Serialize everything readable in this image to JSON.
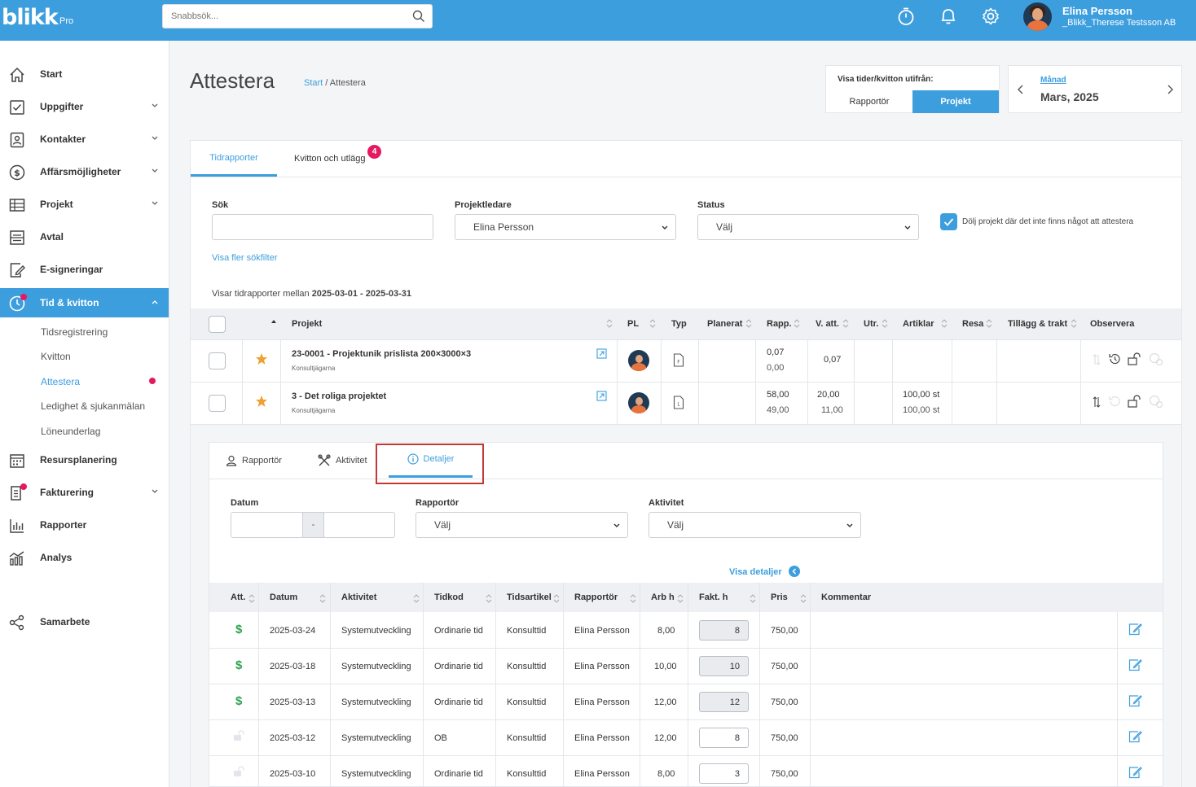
{
  "app": {
    "logo": "blikk",
    "logo_sub": "Pro"
  },
  "search": {
    "placeholder": "Snabbsök..."
  },
  "user": {
    "name": "Elina Persson",
    "company": "_Blikk_Therese Testsson AB"
  },
  "sidebar": {
    "items": [
      {
        "label": "Start",
        "icon": "home-icon"
      },
      {
        "label": "Uppgifter",
        "icon": "checkbox-icon"
      },
      {
        "label": "Kontakter",
        "icon": "contact-icon"
      },
      {
        "label": "Affärsmöjligheter",
        "icon": "dollar-icon"
      },
      {
        "label": "Projekt",
        "icon": "table-icon"
      },
      {
        "label": "Avtal",
        "icon": "contract-icon"
      },
      {
        "label": "E-signeringar",
        "icon": "signature-icon"
      },
      {
        "label": "Tid & kvitton",
        "icon": "clock-icon"
      },
      {
        "label": "Resursplanering",
        "icon": "calendar-icon"
      },
      {
        "label": "Fakturering",
        "icon": "invoice-icon"
      },
      {
        "label": "Rapporter",
        "icon": "bar-chart-icon"
      },
      {
        "label": "Analys",
        "icon": "analytics-icon"
      },
      {
        "label": "Samarbete",
        "icon": "share-icon"
      }
    ],
    "sub_items": [
      "Tidsregistrering",
      "Kvitton",
      "Attestera",
      "Ledighet & sjukanmälan",
      "Löneunderlag"
    ]
  },
  "page": {
    "title": "Attestera",
    "breadcrumb_link": "Start",
    "breadcrumb_sep": " / ",
    "breadcrumb_current": "Attestera"
  },
  "view_toggle": {
    "label": "Visa tider/kvitton utifrån:",
    "options": [
      "Rapportör",
      "Projekt"
    ],
    "selected": "Projekt"
  },
  "period": {
    "type": "Månad",
    "value": "Mars, 2025"
  },
  "tabs": {
    "items": [
      "Tidrapporter",
      "Kvitton och utlägg"
    ],
    "badge": "4"
  },
  "filters": {
    "search_label": "Sök",
    "search_value": "",
    "leader_label": "Projektledare",
    "leader_value": "Elina Persson",
    "status_label": "Status",
    "status_value": "Välj",
    "hide_label": "Dölj projekt där det inte finns något att attestera",
    "hide_checked": true,
    "more_filters": "Visa fler sökfilter"
  },
  "range_text": {
    "prefix": "Visar tidrapporter mellan ",
    "value": "2025-03-01 - 2025-03-31"
  },
  "project_table": {
    "headers": [
      "Projekt",
      "PL",
      "Typ",
      "Planerat",
      "Rapp.",
      "V. att.",
      "Utr.",
      "Artiklar",
      "Resa",
      "Tillägg & trakt",
      "Observera"
    ],
    "rows": [
      {
        "name": "23-0001 - Projektunik prislista 200×3000×3",
        "customer": "Konsultjägarna",
        "rapp": "0,07",
        "rapp2": "0,00",
        "vatt": "0,07",
        "artiklar": "",
        "artiklar2": ""
      },
      {
        "name": "3 - Det roliga projektet",
        "customer": "Konsultjägarna",
        "rapp": "58,00",
        "rapp2": "49,00",
        "vatt": "20,00",
        "vatt2": "11,00",
        "artiklar": "100,00 st",
        "artiklar2": "100,00 st"
      }
    ]
  },
  "detail_tabs": {
    "items": [
      "Rapportör",
      "Aktivitet",
      "Detaljer"
    ],
    "active": "Detaljer"
  },
  "detail_filters": {
    "date_label": "Datum",
    "date_sep": "-",
    "reporter_label": "Rapportör",
    "reporter_value": "Välj",
    "activity_label": "Aktivitet",
    "activity_value": "Välj",
    "show_details": "Visa detaljer"
  },
  "detail_table": {
    "headers": [
      "Att.",
      "Datum",
      "Aktivitet",
      "Tidkod",
      "Tidsartikel",
      "Rapportör",
      "Arb h",
      "Fakt. h",
      "Pris",
      "Kommentar"
    ],
    "rows": [
      {
        "att": "$",
        "date": "2025-03-24",
        "activity": "Systemutveckling",
        "code": "Ordinarie tid",
        "article": "Konsulttid",
        "reporter": "Elina Persson",
        "arb": "8,00",
        "fakt": "8",
        "pris": "750,00",
        "locked": false
      },
      {
        "att": "$",
        "date": "2025-03-18",
        "activity": "Systemutveckling",
        "code": "Ordinarie tid",
        "article": "Konsulttid",
        "reporter": "Elina Persson",
        "arb": "10,00",
        "fakt": "10",
        "pris": "750,00",
        "locked": false
      },
      {
        "att": "$",
        "date": "2025-03-13",
        "activity": "Systemutveckling",
        "code": "Ordinarie tid",
        "article": "Konsulttid",
        "reporter": "Elina Persson",
        "arb": "12,00",
        "fakt": "12",
        "pris": "750,00",
        "locked": false
      },
      {
        "att": "",
        "date": "2025-03-12",
        "activity": "Systemutveckling",
        "code": "OB",
        "article": "Konsulttid",
        "reporter": "Elina Persson",
        "arb": "12,00",
        "fakt": "8",
        "pris": "750,00",
        "locked": true
      },
      {
        "att": "",
        "date": "2025-03-10",
        "activity": "Systemutveckling",
        "code": "Ordinarie tid",
        "article": "Konsulttid",
        "reporter": "Elina Persson",
        "arb": "8,00",
        "fakt": "3",
        "pris": "750,00",
        "locked": true
      }
    ]
  },
  "colors": {
    "brand": "#3d9ede",
    "badge": "#e5195f",
    "money": "#2ea44f",
    "highlight": "#c23a36"
  }
}
